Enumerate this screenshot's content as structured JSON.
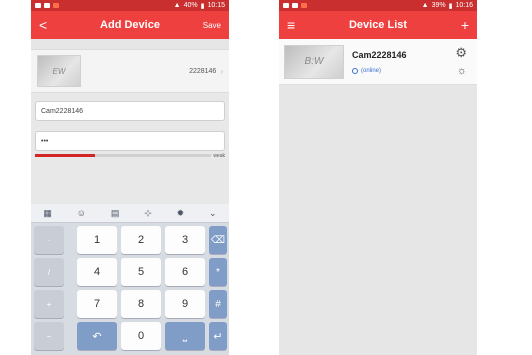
{
  "left": {
    "status": {
      "time": "10:15",
      "battery": "40%"
    },
    "title": "Add Device",
    "back": "<",
    "save": "Save",
    "device": {
      "thumb_text": "EW",
      "serial": "2228146",
      "chevron": "›"
    },
    "name_value": "Cam2228146",
    "password_value": "•••",
    "password_strength": {
      "fraction": 0.34,
      "label": "weak"
    },
    "keyboard": {
      "tools": [
        "keyboard-icon",
        "emoji-icon",
        "keyboard-layout-icon",
        "cursor-icon",
        "settings-icon",
        "hide-keyboard-icon"
      ],
      "side_keys": [
        "·",
        "/",
        "+",
        "−"
      ],
      "numbers": [
        "1",
        "2",
        "3",
        "4",
        "5",
        "6",
        "7",
        "8",
        "9",
        "0"
      ],
      "symbols": {
        "delete": "⌫",
        "star": "*",
        "hash": "#",
        "space": "⎵",
        "enter": "↵",
        "lang": "符",
        "undo": "↶"
      }
    }
  },
  "right": {
    "status": {
      "time": "10:16",
      "battery": "39%"
    },
    "title": "Device List",
    "menu": "≡",
    "add": "+",
    "device": {
      "thumb_text": "B:W",
      "name": "Cam2228146",
      "status": "(online)"
    }
  }
}
